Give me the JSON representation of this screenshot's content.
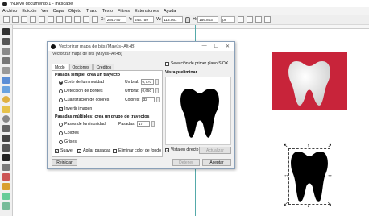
{
  "window": {
    "title": "*Nuevo documento 1 - Inkscape"
  },
  "menu": [
    "Archivo",
    "Edición",
    "Ver",
    "Capa",
    "Objeto",
    "Trazo",
    "Texto",
    "Filtros",
    "Extensiones",
    "Ayuda"
  ],
  "toolbar": {
    "x_label": "X:",
    "x_value": "284.740",
    "y_label": "Y:",
    "y_value": "246.759",
    "w_label": "W:",
    "w_value": "113.561",
    "h_label": "H:",
    "h_value": "156.803",
    "unit": "px"
  },
  "dialog": {
    "title": "Vectorizar mapa de bits (Mayús+Alt+B)",
    "subtitle": "Vectorizar mapa de bits (Mayús+Alt+B)",
    "tabs": [
      "Modo",
      "Opciones",
      "Créditos"
    ],
    "single_scan": {
      "heading": "Pasada simple: crea un trayecto",
      "brightness": "Corte de luminosidad",
      "edges": "Detección de bordes",
      "colors_q": "Cuantización de colores",
      "invert": "Invertir imagen",
      "threshold_label": "Umbral:",
      "threshold_value": "0,770",
      "threshold2_label": "Umbral:",
      "threshold2_value": "0,650",
      "colors_label": "Colores:",
      "colors_value": "32"
    },
    "multi_scan": {
      "heading": "Pasadas múltiples: crea un grupo de trayectos",
      "steps": "Pasos de luminosidad",
      "colors": "Colores",
      "grays": "Grises",
      "scans_label": "Pasadas:",
      "scans_value": "17",
      "smooth": "Suave",
      "stack": "Apilar pasadas",
      "remove_bg": "Eliminar color de fondo"
    },
    "siox": "Selección de primer plano SIOX",
    "preview_label": "Vista preliminar",
    "live_preview": "Vista en directo",
    "update": "Actualizar",
    "reset": "Reiniciar",
    "stop": "Detener",
    "ok": "Aceptar",
    "minimize": "—",
    "maximize": "☐",
    "close": "✕"
  }
}
